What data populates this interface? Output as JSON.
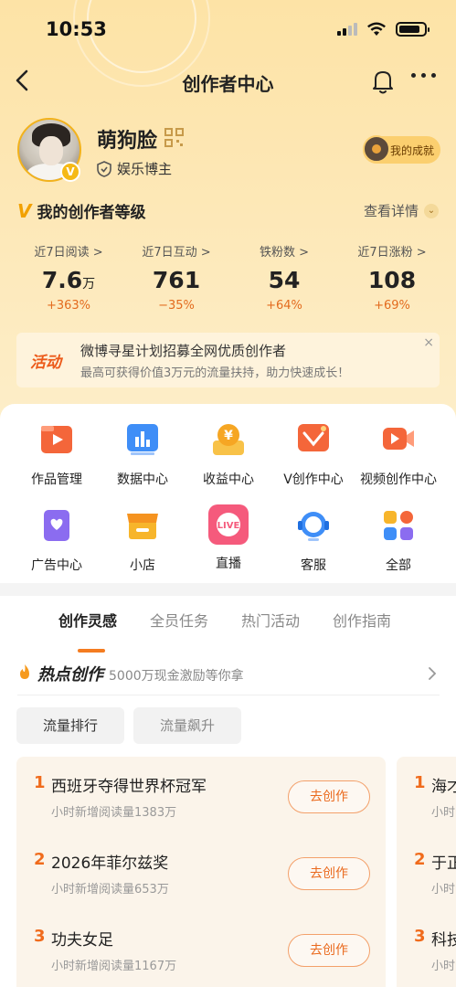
{
  "status_bar": {
    "time": "10:53"
  },
  "nav": {
    "title": "创作者中心"
  },
  "profile": {
    "name": "萌狗脸",
    "role": "娱乐博主",
    "badge": "V",
    "achievement_label": "我的成就"
  },
  "level": {
    "icon": "V",
    "title": "我的创作者等级",
    "detail_label": "查看详情"
  },
  "stats": [
    {
      "label": "近7日阅读 >",
      "value": "7.6",
      "unit": "万",
      "change": "+363%"
    },
    {
      "label": "近7日互动 >",
      "value": "761",
      "unit": "",
      "change": "−35%"
    },
    {
      "label": "铁粉数 >",
      "value": "54",
      "unit": "",
      "change": "+64%"
    },
    {
      "label": "近7日涨粉 >",
      "value": "108",
      "unit": "",
      "change": "+69%"
    }
  ],
  "banner": {
    "tag": "活动",
    "title": "微博寻星计划招募全网优质创作者",
    "subtitle": "最高可获得价值3万元的流量扶持，助力快速成长！",
    "close": "×"
  },
  "tools": [
    {
      "label": "作品管理",
      "icon": "works-icon",
      "color": "#f4663a"
    },
    {
      "label": "数据中心",
      "icon": "data-icon",
      "color": "#3f8ef7"
    },
    {
      "label": "收益中心",
      "icon": "income-icon",
      "color": "#f6a623"
    },
    {
      "label": "V创作中心",
      "icon": "v-create-icon",
      "color": "#f4663a"
    },
    {
      "label": "视频创作中心",
      "icon": "video-icon",
      "color": "#f4663a"
    },
    {
      "label": "广告中心",
      "icon": "ad-icon",
      "color": "#8b6cf0"
    },
    {
      "label": "小店",
      "icon": "shop-icon",
      "color": "#f7b52b"
    },
    {
      "label": "直播",
      "icon": "live-icon",
      "color": "#f55a7c"
    },
    {
      "label": "客服",
      "icon": "service-icon",
      "color": "#3f8ef7"
    },
    {
      "label": "全部",
      "icon": "all-icon",
      "color": "#f4663a"
    }
  ],
  "tabs": [
    "创作灵感",
    "全员任务",
    "热门活动",
    "创作指南"
  ],
  "hot": {
    "title": "热点创作",
    "subtitle": "5000万现金激励等你拿"
  },
  "pills": [
    "流量排行",
    "流量飙升"
  ],
  "hot_list": [
    {
      "rank": "1",
      "title": "西班牙夺得世界杯冠军",
      "sub": "小时新增阅读量1383万",
      "button": "去创作"
    },
    {
      "rank": "2",
      "title": "2026年菲尔兹奖",
      "sub": "小时新增阅读量653万",
      "button": "去创作"
    },
    {
      "rank": "3",
      "title": "功夫女足",
      "sub": "小时新增阅读量1167万",
      "button": "去创作"
    }
  ],
  "hot_list_next": [
    {
      "rank": "1",
      "title": "海才",
      "sub": "小时"
    },
    {
      "rank": "2",
      "title": "于正",
      "sub": "小时"
    },
    {
      "rank": "3",
      "title": "科技",
      "sub": "小时"
    }
  ]
}
